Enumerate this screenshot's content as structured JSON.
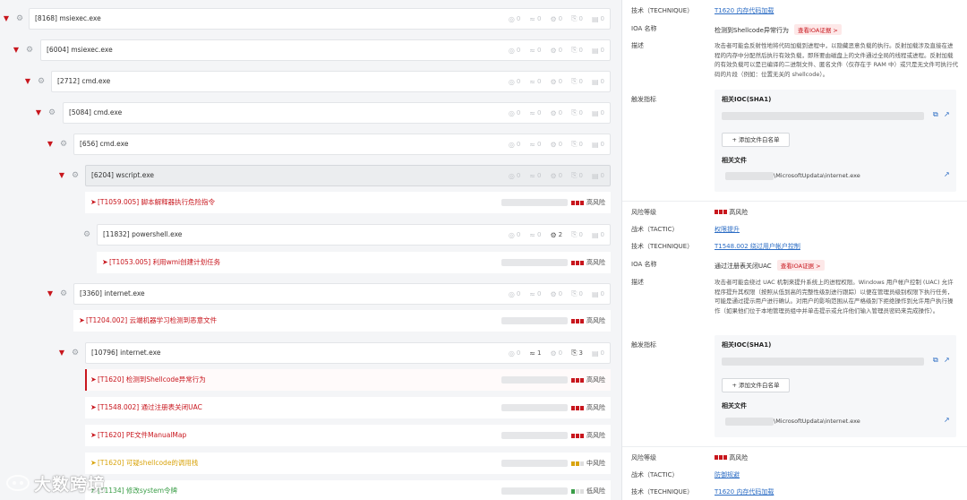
{
  "stat_icons": [
    "network-icon",
    "wifi-icon",
    "registry-icon",
    "share-icon",
    "file-icon"
  ],
  "tree": {
    "processes": [
      {
        "name": "[8168] msiexec.exe",
        "stats": [
          "0",
          "0",
          "0",
          "0",
          "0"
        ]
      },
      {
        "name": "[6004] msiexec.exe",
        "stats": [
          "0",
          "0",
          "0",
          "0",
          "0"
        ]
      },
      {
        "name": "[2712] cmd.exe",
        "stats": [
          "0",
          "0",
          "0",
          "0",
          "0"
        ]
      },
      {
        "name": "[5084] cmd.exe",
        "stats": [
          "0",
          "0",
          "0",
          "0",
          "0"
        ]
      },
      {
        "name": "[656] cmd.exe",
        "stats": [
          "0",
          "0",
          "0",
          "0",
          "0"
        ]
      },
      {
        "name": "[6204] wscript.exe",
        "stats": [
          "0",
          "0",
          "0",
          "0",
          "0"
        ]
      },
      {
        "name": "[11832] powershell.exe",
        "stats": [
          "0",
          "0",
          "2",
          "0",
          "0"
        ]
      },
      {
        "name": "[3360] internet.exe",
        "stats": [
          "0",
          "0",
          "0",
          "0",
          "0"
        ]
      },
      {
        "name": "[10796] internet.exe",
        "stats": [
          "0",
          "1",
          "0",
          "3",
          "0"
        ]
      }
    ],
    "alerts": [
      {
        "text": "[T1059.005] 脚本解释器执行危险指令",
        "risk": "高风险",
        "color": "#c8161d"
      },
      {
        "text": "[T1053.005] 利用wmi创建计划任务",
        "risk": "高风险",
        "color": "#c8161d"
      },
      {
        "text": "[T1204.002] 云端机器学习检测到恶意文件",
        "risk": "高风险",
        "color": "#c8161d"
      },
      {
        "text": "[T1620] 检测到Shellcode异常行为",
        "risk": "高风险",
        "color": "#c8161d"
      },
      {
        "text": "[T1548.002] 通过注册表关闭UAC",
        "risk": "高风险",
        "color": "#c8161d"
      },
      {
        "text": "[T1620] PE文件ManualMap",
        "risk": "高风险",
        "color": "#c8161d"
      },
      {
        "text": "[T1620] 可疑shellcode的调用栈",
        "risk": "中风险",
        "color": "#d9a40e"
      },
      {
        "text": "[T1134] 修改system令牌",
        "risk": "低风险",
        "color": "#3a9d47"
      }
    ]
  },
  "detail1": {
    "tech_label": "技术（TECHNIQUE）",
    "tech_value": "T1620 内存代码加载",
    "ioa_label": "IOA 名称",
    "ioa_value": "检测到Shellcode异常行为",
    "ioa_btn": "查看IOA证据 >",
    "desc_label": "描述",
    "desc": "攻击者可能会反射性地将代码加载到进程中，以隐藏恶意负载的执行。反射加载涉及直接在进程的内存中分配然后执行有效负载，即所要由磁盘上的文件通过全局的线程或进程。反射加载的有效负载可以是已编译的二进制文件、匿名文件（仅存在于 RAM 中）或只是无文件可执行代码的片段（例如：位置无关的 shellcode）。",
    "trigger_label": "触发指标",
    "ioc_title": "相关IOC(SHA1)",
    "add_btn": "+ 添加文件白名单",
    "file_title": "相关文件",
    "file_path": "\\MicrosoftUpdata\\internet.exe"
  },
  "detail2": {
    "risk_label": "风险等级",
    "risk_value": "高风险",
    "tactic_label": "战术（TACTIC）",
    "tactic_value": "权限提升",
    "tech_label": "技术（TECHNIQUE）",
    "tech_value": "T1548.002 绕过用户帐户控制",
    "ioa_label": "IOA 名称",
    "ioa_value": "通过注册表关闭UAC",
    "ioa_btn": "查看IOA证据 >",
    "desc_label": "描述",
    "desc": "攻击者可能会绕过 UAC 机制来提升系统上的进程权限。Windows 用户帐户控制 (UAC) 允许程序提升其权限（按照从低到高的完整性级别进行跟踪）以便在管理员级别权限下执行任务，可能是通过提示用户进行确认。对用户的影响范围从在严格级别下拒绝操作到允许用户执行操作（如果他们位于本地管理员组中并单击提示或允许他们输入管理员密码来完成操作）。",
    "trigger_label": "触发指标",
    "ioc_title": "相关IOC(SHA1)",
    "add_btn": "+ 添加文件白名单",
    "file_title": "相关文件",
    "file_path": "\\MicrosoftUpdata\\internet.exe"
  },
  "detail3": {
    "risk_label": "风险等级",
    "risk_value": "高风险",
    "tactic_label": "战术（TACTIC）",
    "tactic_value": "防御规避",
    "tech_label": "技术（TECHNIQUE）",
    "tech_value": "T1620 内存代码加载"
  },
  "watermark": "大数跨境",
  "colors": {
    "accent": "#c8161d",
    "link": "#2b6cc4",
    "medium": "#d9a40e",
    "low": "#3a9d47"
  }
}
